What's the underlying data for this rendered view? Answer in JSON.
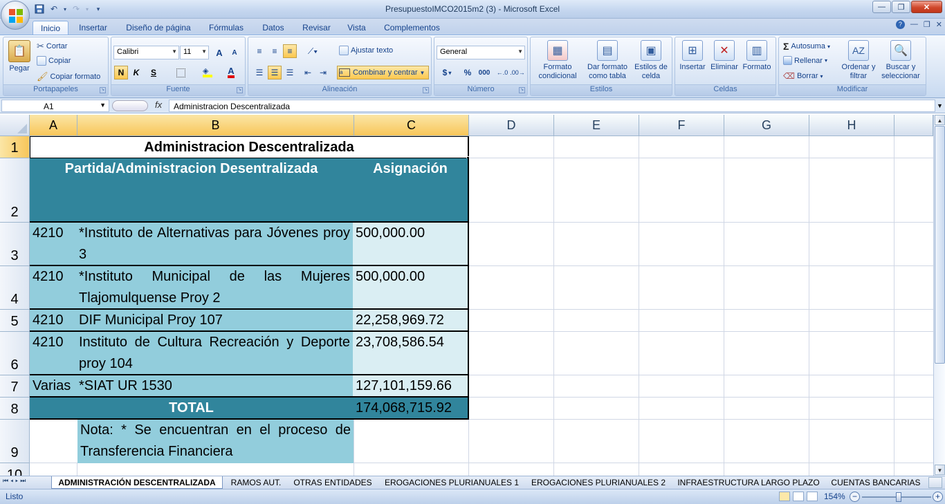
{
  "app": {
    "title": "PresupuestoIMCO2015m2 (3) - Microsoft Excel",
    "window_buttons": {
      "minimize": "—",
      "restore": "❐",
      "close": "✕"
    }
  },
  "ribbon_tabs": [
    "Inicio",
    "Insertar",
    "Diseño de página",
    "Fórmulas",
    "Datos",
    "Revisar",
    "Vista",
    "Complementos"
  ],
  "ribbon": {
    "clipboard": {
      "label": "Portapapeles",
      "paste": "Pegar",
      "cut": "Cortar",
      "copy": "Copiar",
      "format_painter": "Copiar formato"
    },
    "font": {
      "label": "Fuente",
      "name": "Calibri",
      "size": "11",
      "bold": "N",
      "italic": "K",
      "underline": "S",
      "grow": "A",
      "shrink": "A"
    },
    "alignment": {
      "label": "Alineación",
      "wrap": "Ajustar texto",
      "merge": "Combinar y centrar"
    },
    "number": {
      "label": "Número",
      "format": "General",
      "currency": "$",
      "percent": "%",
      "thousands": "000"
    },
    "styles": {
      "label": "Estilos",
      "conditional": "Formato condicional",
      "as_table": "Dar formato como tabla",
      "cell_styles": "Estilos de celda"
    },
    "cells": {
      "label": "Celdas",
      "insert": "Insertar",
      "delete": "Eliminar",
      "format": "Formato"
    },
    "editing": {
      "label": "Modificar",
      "autosum": "Autosuma",
      "fill": "Rellenar",
      "clear": "Borrar",
      "sort": "Ordenar y filtrar",
      "find": "Buscar y seleccionar"
    }
  },
  "formula_bar": {
    "name_box": "A1",
    "fx": "fx",
    "formula": "Administracion Descentralizada"
  },
  "columns": [
    "A",
    "B",
    "C",
    "D",
    "E",
    "F",
    "G",
    "H"
  ],
  "rows": [
    "1",
    "2",
    "3",
    "4",
    "5",
    "6",
    "7",
    "8",
    "9",
    "10"
  ],
  "sheet": {
    "title": "Administracion Descentralizada",
    "header_partida": "Partida/Administracion Desentralizada",
    "header_asignacion": "Asignación",
    "data_rows": [
      {
        "code": "4210",
        "name": "*Instituto de Alternativas para Jóvenes proy 3",
        "amount": "500,000.00"
      },
      {
        "code": "4210",
        "name": "*Instituto Municipal de las Mujeres Tlajomulquense Proy 2",
        "amount": "500,000.00"
      },
      {
        "code": "4210",
        "name": "DIF Municipal Proy 107",
        "amount": "22,258,969.72"
      },
      {
        "code": "4210",
        "name": "Instituto de Cultura Recreación y Deporte proy 104",
        "amount": "23,708,586.54"
      },
      {
        "code": "Varias",
        "name": "*SIAT UR 1530",
        "amount": "127,101,159.66"
      }
    ],
    "total_label": "TOTAL",
    "total_amount": "174,068,715.92",
    "note": "Nota: * Se encuentran en el proceso de Transferencia Financiera"
  },
  "sheet_tabs": [
    "ADMINISTRACIÓN DESCENTRALIZADA",
    "RAMOS AUT.",
    "OTRAS ENTIDADES",
    "EROGACIONES PLURIANUALES 1",
    "EROGACIONES PLURIANUALES 2",
    "INFRAESTRUCTURA LARGO PLAZO",
    "CUENTAS BANCARIAS"
  ],
  "status": {
    "text": "Listo",
    "zoom": "154%"
  },
  "colors": {
    "dark_teal": "#31859c",
    "light_teal": "#92cddc",
    "pale_teal": "#daeef3"
  }
}
